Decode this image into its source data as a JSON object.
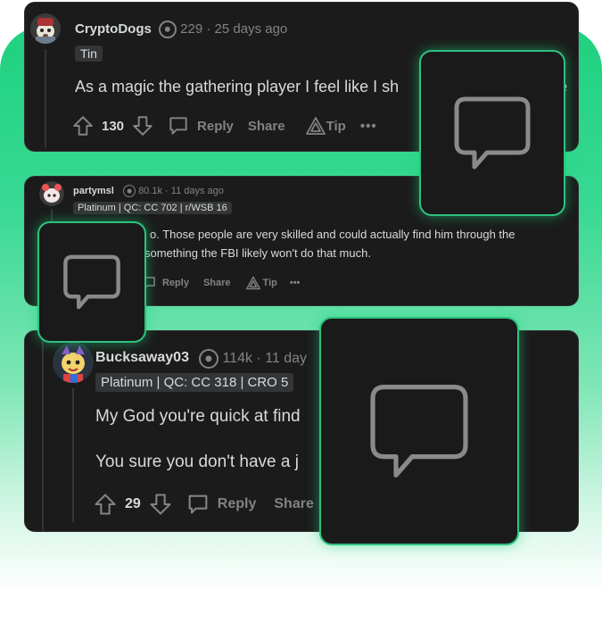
{
  "comments": [
    {
      "username": "CryptoDogs",
      "karma": "229",
      "age": "25 days ago",
      "flair": "Tin",
      "body_lines": [
        "As a magic the gathering player I feel like I sh"
      ],
      "body_tail": "e",
      "vote_count": "130",
      "reply_label": "Reply",
      "share_label": "Share",
      "tip_label": "Tip",
      "more_label": "•••"
    },
    {
      "username": "partymsl",
      "karma": "80.1k",
      "age": "11 days ago",
      "flair": "Platinum | QC: CC 702 | r/WSB 16",
      "body_lines": [
        "o. Those people are very skilled and could actually find him through the",
        "something the FBI likely won't do that much."
      ],
      "reply_label": "Reply",
      "share_label": "Share",
      "tip_label": "Tip",
      "more_label": "•••"
    },
    {
      "username": "Bucksaway03",
      "karma": "114k",
      "age": "11 day",
      "flair": "Platinum | QC: CC 318 | CRO 5",
      "body_lines": [
        "My God you're quick at find",
        "You sure you don't have a j"
      ],
      "vote_count": "29",
      "reply_label": "Reply",
      "share_label": "Share"
    }
  ],
  "colors": {
    "card_bg": "#1b1b1b",
    "accent_green": "#1fd17e",
    "muted_text": "#818384",
    "body_text": "#d7dadc"
  }
}
